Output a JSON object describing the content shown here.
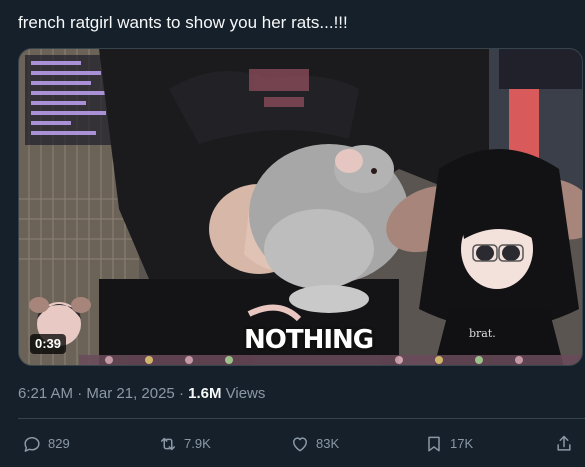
{
  "tweet": {
    "text": "french ratgirl wants to show you her rats...!!!"
  },
  "media": {
    "duration": "0:39",
    "caption": "NOTHING"
  },
  "meta": {
    "time": "6:21 AM",
    "separator1": " · ",
    "date": "Mar 21, 2025",
    "separator2": " · ",
    "views_count": "1.6M",
    "views_label": " Views"
  },
  "actions": {
    "reply_count": "829",
    "repost_count": "7.9K",
    "like_count": "83K",
    "bookmark_count": "17K"
  },
  "colors": {
    "background": "#15202b",
    "text_primary": "#f7f9f9",
    "text_secondary": "#8b98a5",
    "divider": "#38444d"
  }
}
